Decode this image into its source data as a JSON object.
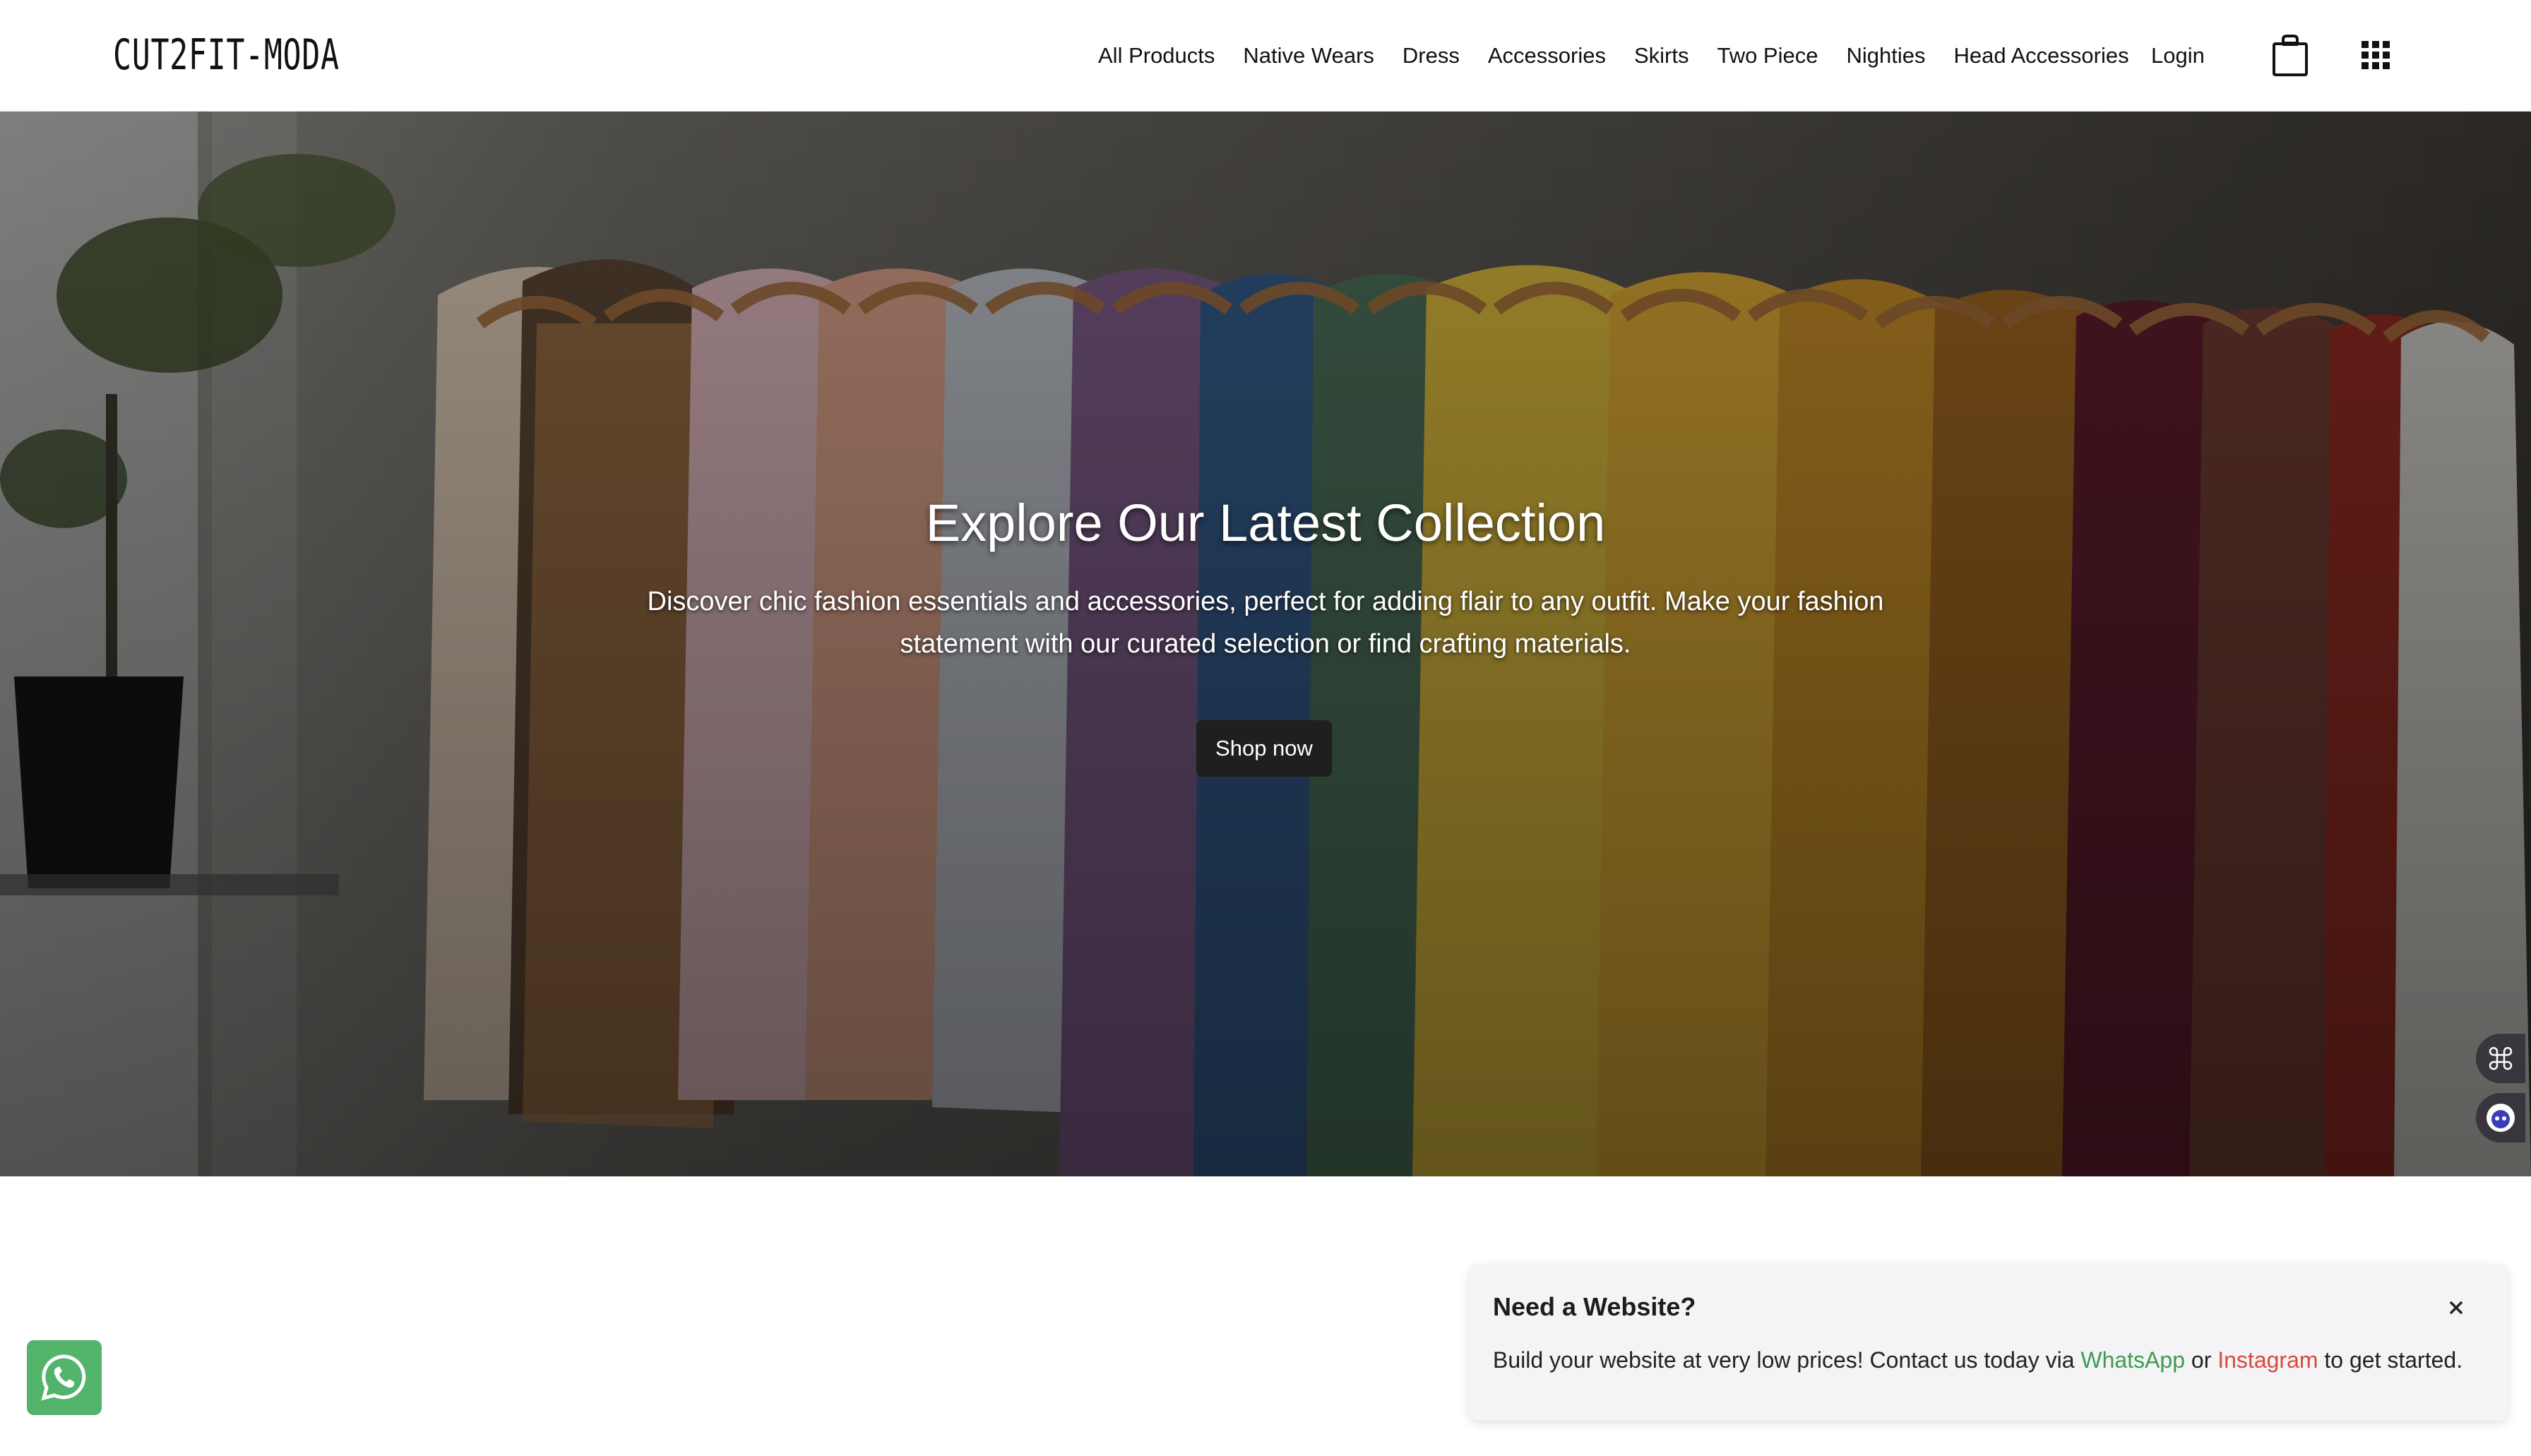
{
  "header": {
    "logo": "CUT2FIT-MODA",
    "nav": [
      {
        "label": "All Products"
      },
      {
        "label": "Native Wears"
      },
      {
        "label": "Dress"
      },
      {
        "label": "Accessories"
      },
      {
        "label": "Skirts"
      },
      {
        "label": "Two Piece"
      },
      {
        "label": "Nighties"
      },
      {
        "label": "Head Accessories"
      }
    ],
    "login_label": "Login",
    "cart_icon": "shopping-bag-icon",
    "apps_icon": "grid-menu-icon"
  },
  "hero": {
    "title": "Explore Our Latest Collection",
    "subtitle": "Discover chic fashion essentials and accessories, perfect for adding flair to any outfit. Make your fashion statement with our curated selection or find crafting materials.",
    "button_label": "Shop now"
  },
  "side_buttons": [
    {
      "icon": "command-icon"
    },
    {
      "icon": "bot-face-icon"
    }
  ],
  "popup": {
    "title": "Need a Website?",
    "text_before": "Build your website at very low prices! Contact us today via ",
    "whatsapp_label": "WhatsApp",
    "text_middle": " or ",
    "instagram_label": "Instagram",
    "text_after": " to get started.",
    "close_icon": "close-icon"
  },
  "whatsapp_float": {
    "icon": "whatsapp-icon"
  },
  "colors": {
    "accent_green": "#3f9a53",
    "accent_red": "#d84a3c",
    "whatsapp_bg": "#52b46a",
    "button_dark": "#1f1f1f"
  }
}
